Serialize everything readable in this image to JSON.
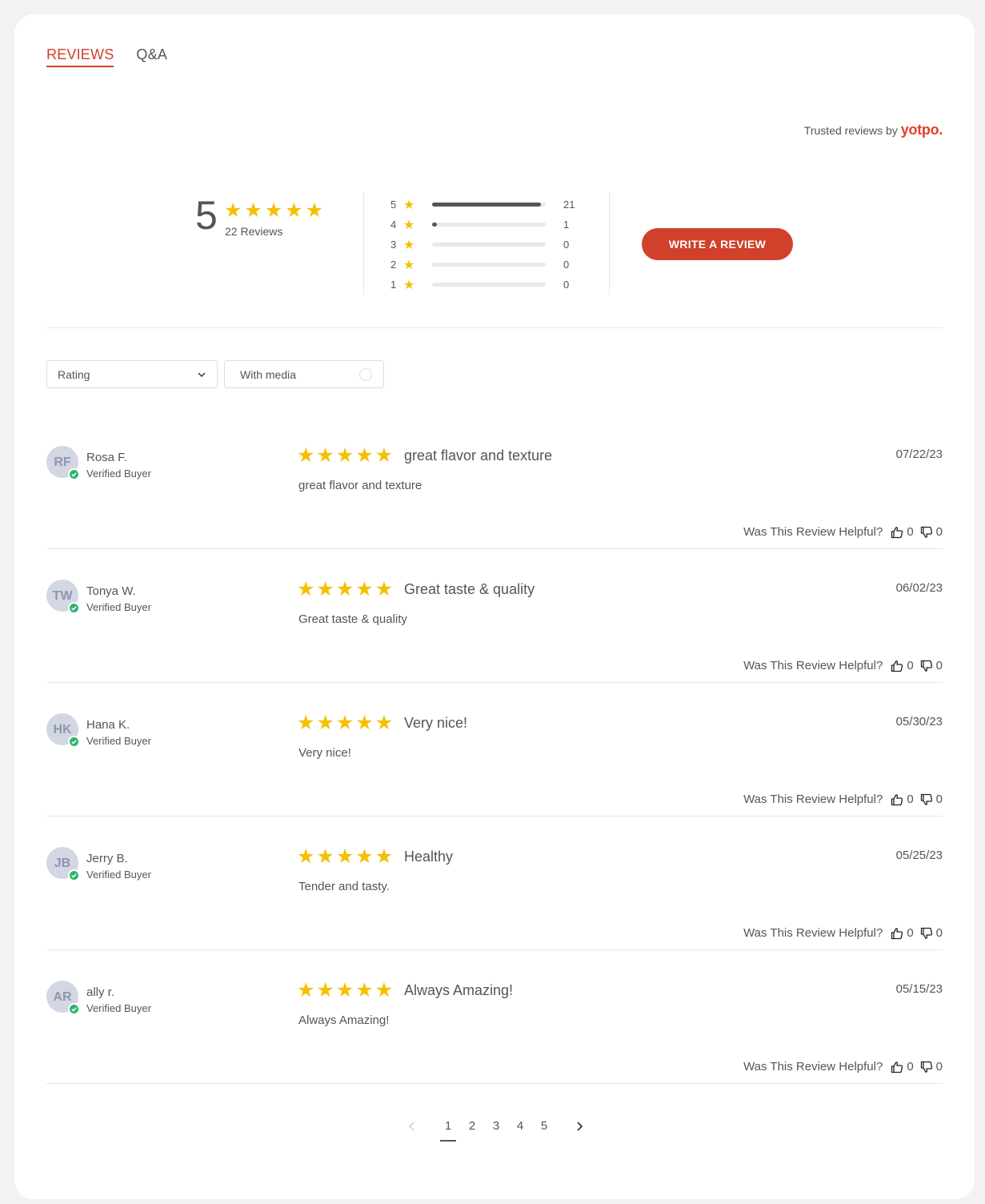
{
  "tabs": [
    {
      "label": "REVIEWS",
      "active": true
    },
    {
      "label": "Q&A",
      "active": false
    }
  ],
  "trusted": {
    "text": "Trusted reviews by",
    "brand": "yotpo."
  },
  "summary": {
    "average": "5",
    "average_rating": 5,
    "reviews_count_text": "22 Reviews",
    "distribution": [
      {
        "stars": "5",
        "count": "21",
        "fraction": 0.955
      },
      {
        "stars": "4",
        "count": "1",
        "fraction": 0.045
      },
      {
        "stars": "3",
        "count": "0",
        "fraction": 0
      },
      {
        "stars": "2",
        "count": "0",
        "fraction": 0
      },
      {
        "stars": "1",
        "count": "0",
        "fraction": 0
      }
    ],
    "write_review_label": "WRITE A REVIEW"
  },
  "filters": {
    "rating_label": "Rating",
    "media_label": "With media"
  },
  "helpful_label": "Was This Review Helpful?",
  "reviews": [
    {
      "initials": "RF",
      "name": "Rosa F.",
      "badge": "Verified Buyer",
      "rating": 5,
      "title": "great flavor and texture",
      "body": "great flavor and texture",
      "date": "07/22/23",
      "up": "0",
      "down": "0"
    },
    {
      "initials": "TW",
      "name": "Tonya W.",
      "badge": "Verified Buyer",
      "rating": 5,
      "title": "Great taste & quality",
      "body": "Great taste & quality",
      "date": "06/02/23",
      "up": "0",
      "down": "0"
    },
    {
      "initials": "HK",
      "name": "Hana K.",
      "badge": "Verified Buyer",
      "rating": 5,
      "title": "Very nice!",
      "body": "Very nice!",
      "date": "05/30/23",
      "up": "0",
      "down": "0"
    },
    {
      "initials": "JB",
      "name": "Jerry B.",
      "badge": "Verified Buyer",
      "rating": 5,
      "title": "Healthy",
      "body": "Tender and tasty.",
      "date": "05/25/23",
      "up": "0",
      "down": "0"
    },
    {
      "initials": "AR",
      "name": "ally r.",
      "badge": "Verified Buyer",
      "rating": 5,
      "title": "Always Amazing!",
      "body": "Always Amazing!",
      "date": "05/15/23",
      "up": "0",
      "down": "0"
    }
  ],
  "pagination": {
    "pages": [
      "1",
      "2",
      "3",
      "4",
      "5"
    ],
    "current": "1"
  },
  "colors": {
    "accent": "#d0402a",
    "star": "#f5c000",
    "verified": "#2cb56e",
    "avatar_bg": "#d3d7e3"
  },
  "icons": {
    "star": "star-icon",
    "check": "check-icon",
    "thumbs_up": "thumbs-up-icon",
    "thumbs_down": "thumbs-down-icon",
    "chevron_down": "chevron-down-icon",
    "chevron_left": "chevron-left-icon",
    "chevron_right": "chevron-right-icon"
  }
}
